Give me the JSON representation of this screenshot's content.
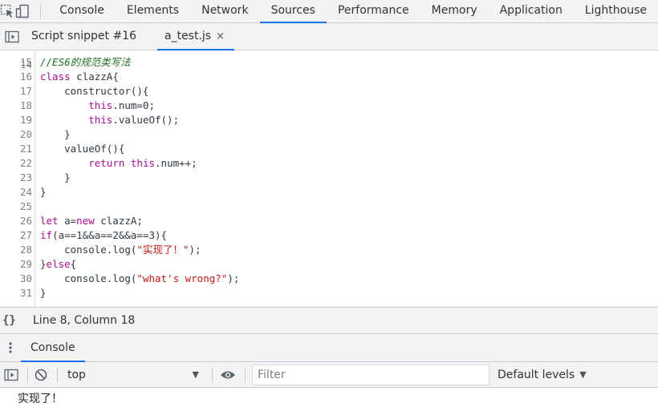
{
  "devtools": {
    "tabs": [
      "Console",
      "Elements",
      "Network",
      "Sources",
      "Performance",
      "Memory",
      "Application",
      "Lighthouse"
    ],
    "active_tab": "Sources"
  },
  "sources": {
    "file_tabs": [
      {
        "label": "Script snippet #16",
        "active": false,
        "closable": false
      },
      {
        "label": "a_test.js",
        "active": true,
        "closable": true
      }
    ],
    "close_glyph": "×",
    "code_lines": [
      {
        "num": "15",
        "segments": [
          {
            "t": "//ES6的规范类写法",
            "c": "cm"
          }
        ]
      },
      {
        "num": "16",
        "segments": [
          {
            "t": "class",
            "c": "kw"
          },
          {
            "t": " clazzA{",
            "c": ""
          }
        ]
      },
      {
        "num": "17",
        "segments": [
          {
            "t": "    constructor(){",
            "c": ""
          }
        ]
      },
      {
        "num": "18",
        "segments": [
          {
            "t": "        ",
            "c": ""
          },
          {
            "t": "this",
            "c": "kw"
          },
          {
            "t": ".num=0;",
            "c": ""
          }
        ]
      },
      {
        "num": "19",
        "segments": [
          {
            "t": "        ",
            "c": ""
          },
          {
            "t": "this",
            "c": "kw"
          },
          {
            "t": ".valueOf();",
            "c": ""
          }
        ]
      },
      {
        "num": "20",
        "segments": [
          {
            "t": "    }",
            "c": ""
          }
        ]
      },
      {
        "num": "21",
        "segments": [
          {
            "t": "    valueOf(){",
            "c": ""
          }
        ]
      },
      {
        "num": "22",
        "segments": [
          {
            "t": "        ",
            "c": ""
          },
          {
            "t": "return",
            "c": "kw"
          },
          {
            "t": " ",
            "c": ""
          },
          {
            "t": "this",
            "c": "kw"
          },
          {
            "t": ".num++;",
            "c": ""
          }
        ]
      },
      {
        "num": "23",
        "segments": [
          {
            "t": "    }",
            "c": ""
          }
        ]
      },
      {
        "num": "24",
        "segments": [
          {
            "t": "}",
            "c": ""
          }
        ]
      },
      {
        "num": "25",
        "segments": []
      },
      {
        "num": "26",
        "segments": [
          {
            "t": "let",
            "c": "kw"
          },
          {
            "t": " a=",
            "c": ""
          },
          {
            "t": "new",
            "c": "kw"
          },
          {
            "t": " clazzA;",
            "c": ""
          }
        ]
      },
      {
        "num": "27",
        "segments": [
          {
            "t": "if",
            "c": "kw"
          },
          {
            "t": "(a==1&&a==2&&a==3){",
            "c": ""
          }
        ]
      },
      {
        "num": "28",
        "segments": [
          {
            "t": "    console.log(",
            "c": ""
          },
          {
            "t": "\"实现了！\"",
            "c": "str"
          },
          {
            "t": ");",
            "c": ""
          }
        ]
      },
      {
        "num": "29",
        "segments": [
          {
            "t": "}",
            "c": ""
          },
          {
            "t": "else",
            "c": "kw"
          },
          {
            "t": "{",
            "c": ""
          }
        ]
      },
      {
        "num": "30",
        "segments": [
          {
            "t": "    console.log(",
            "c": ""
          },
          {
            "t": "\"what's wrong?\"",
            "c": "str"
          },
          {
            "t": ");",
            "c": ""
          }
        ]
      },
      {
        "num": "31",
        "segments": [
          {
            "t": "}",
            "c": ""
          }
        ]
      }
    ],
    "status": {
      "braces": "{}",
      "position": "Line 8, Column 18"
    }
  },
  "drawer": {
    "tab": "Console",
    "toolbar": {
      "context": "top",
      "filter_placeholder": "Filter",
      "levels": "Default levels"
    },
    "messages": [
      "实现了！"
    ]
  },
  "colors": {
    "accent": "#1a73e8",
    "keyword": "#aa0d91",
    "string": "#c41a16",
    "comment": "#236e25"
  }
}
